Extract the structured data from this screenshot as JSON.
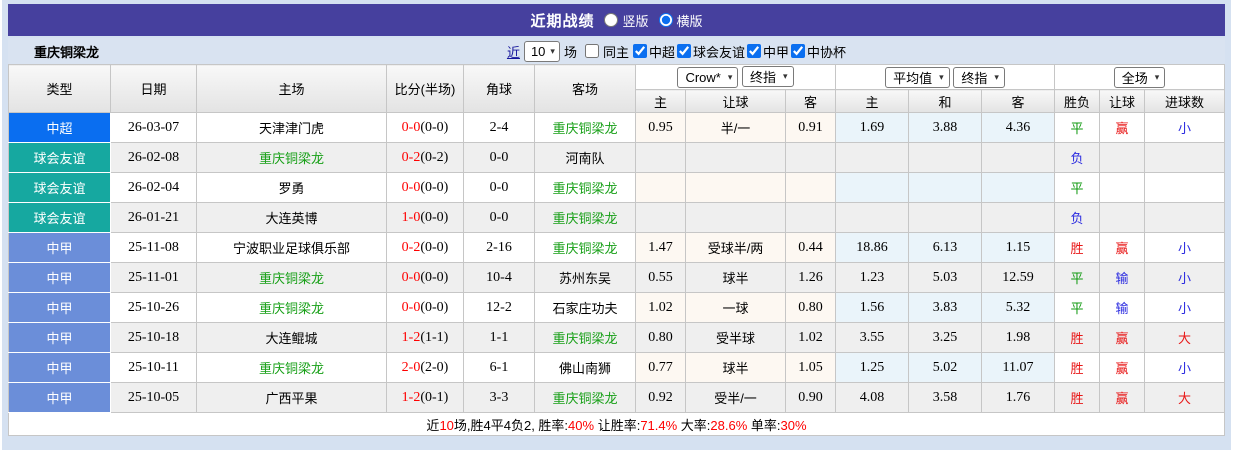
{
  "title_bar": {
    "title": "近期战绩",
    "radio_vertical": "竖版",
    "radio_horizontal": "横版",
    "selected": "横版"
  },
  "filter_bar": {
    "team": "重庆铜梁龙",
    "near_label": "近",
    "count_value": "10",
    "games_label": "场",
    "checkboxes": [
      {
        "label": "同主",
        "checked": false
      },
      {
        "label": "中超",
        "checked": true
      },
      {
        "label": "球会友谊",
        "checked": true
      },
      {
        "label": "中甲",
        "checked": true
      },
      {
        "label": "中协杯",
        "checked": true
      }
    ]
  },
  "selectors": {
    "bookmaker": "Crow*",
    "bookmaker_stage": "终指",
    "average": "平均值",
    "average_stage": "终指",
    "scope": "全场"
  },
  "columns": {
    "type": "类型",
    "date": "日期",
    "home": "主场",
    "score": "比分(半场)",
    "corner": "角球",
    "away": "客场",
    "odds_home": "主",
    "handicap": "让球",
    "odds_away": "客",
    "avg_home": "主",
    "avg_draw": "和",
    "avg_away": "客",
    "result": "胜负",
    "handicap_result": "让球",
    "goals": "进球数"
  },
  "league_colors": {
    "中超": "#0a6ef0",
    "球会友谊": "#16a8a0",
    "中甲": "#6b8ed9"
  },
  "rows": [
    {
      "league": "中超",
      "date": "26-03-07",
      "home": "天津津门虎",
      "home_green": false,
      "score": "0-0",
      "half": "(0-0)",
      "corner": "2-4",
      "away": "重庆铜梁龙",
      "away_green": true,
      "odds_home": "0.95",
      "handicap": "半/一",
      "odds_away": "0.91",
      "avg_home": "1.69",
      "avg_draw": "3.88",
      "avg_away": "4.36",
      "result": "平",
      "result_color": "green",
      "hresult": "赢",
      "hresult_color": "red",
      "goals": "小",
      "goals_color": "blue"
    },
    {
      "league": "球会友谊",
      "date": "26-02-08",
      "home": "重庆铜梁龙",
      "home_green": true,
      "score": "0-2",
      "half": "(0-2)",
      "corner": "0-0",
      "away": "河南队",
      "away_green": false,
      "odds_home": "",
      "handicap": "",
      "odds_away": "",
      "avg_home": "",
      "avg_draw": "",
      "avg_away": "",
      "result": "负",
      "result_color": "blue",
      "hresult": "",
      "hresult_color": "",
      "goals": "",
      "goals_color": ""
    },
    {
      "league": "球会友谊",
      "date": "26-02-04",
      "home": "罗勇",
      "home_green": false,
      "score": "0-0",
      "half": "(0-0)",
      "corner": "0-0",
      "away": "重庆铜梁龙",
      "away_green": true,
      "odds_home": "",
      "handicap": "",
      "odds_away": "",
      "avg_home": "",
      "avg_draw": "",
      "avg_away": "",
      "result": "平",
      "result_color": "green",
      "hresult": "",
      "hresult_color": "",
      "goals": "",
      "goals_color": ""
    },
    {
      "league": "球会友谊",
      "date": "26-01-21",
      "home": "大连英博",
      "home_green": false,
      "score": "1-0",
      "half": "(0-0)",
      "corner": "0-0",
      "away": "重庆铜梁龙",
      "away_green": true,
      "odds_home": "",
      "handicap": "",
      "odds_away": "",
      "avg_home": "",
      "avg_draw": "",
      "avg_away": "",
      "result": "负",
      "result_color": "blue",
      "hresult": "",
      "hresult_color": "",
      "goals": "",
      "goals_color": ""
    },
    {
      "league": "中甲",
      "date": "25-11-08",
      "home": "宁波职业足球俱乐部",
      "home_green": false,
      "score": "0-2",
      "half": "(0-0)",
      "corner": "2-16",
      "away": "重庆铜梁龙",
      "away_green": true,
      "odds_home": "1.47",
      "handicap": "受球半/两",
      "odds_away": "0.44",
      "avg_home": "18.86",
      "avg_draw": "6.13",
      "avg_away": "1.15",
      "result": "胜",
      "result_color": "red",
      "hresult": "赢",
      "hresult_color": "red",
      "goals": "小",
      "goals_color": "blue"
    },
    {
      "league": "中甲",
      "date": "25-11-01",
      "home": "重庆铜梁龙",
      "home_green": true,
      "score": "0-0",
      "half": "(0-0)",
      "corner": "10-4",
      "away": "苏州东吴",
      "away_green": false,
      "odds_home": "0.55",
      "handicap": "球半",
      "odds_away": "1.26",
      "avg_home": "1.23",
      "avg_draw": "5.03",
      "avg_away": "12.59",
      "result": "平",
      "result_color": "green",
      "hresult": "输",
      "hresult_color": "blue",
      "goals": "小",
      "goals_color": "blue"
    },
    {
      "league": "中甲",
      "date": "25-10-26",
      "home": "重庆铜梁龙",
      "home_green": true,
      "score": "0-0",
      "half": "(0-0)",
      "corner": "12-2",
      "away": "石家庄功夫",
      "away_green": false,
      "odds_home": "1.02",
      "handicap": "一球",
      "odds_away": "0.80",
      "avg_home": "1.56",
      "avg_draw": "3.83",
      "avg_away": "5.32",
      "result": "平",
      "result_color": "green",
      "hresult": "输",
      "hresult_color": "blue",
      "goals": "小",
      "goals_color": "blue"
    },
    {
      "league": "中甲",
      "date": "25-10-18",
      "home": "大连鲲城",
      "home_green": false,
      "score": "1-2",
      "half": "(1-1)",
      "corner": "1-1",
      "away": "重庆铜梁龙",
      "away_green": true,
      "odds_home": "0.80",
      "handicap": "受半球",
      "odds_away": "1.02",
      "avg_home": "3.55",
      "avg_draw": "3.25",
      "avg_away": "1.98",
      "result": "胜",
      "result_color": "red",
      "hresult": "赢",
      "hresult_color": "red",
      "goals": "大",
      "goals_color": "red"
    },
    {
      "league": "中甲",
      "date": "25-10-11",
      "home": "重庆铜梁龙",
      "home_green": true,
      "score": "2-0",
      "half": "(2-0)",
      "corner": "6-1",
      "away": "佛山南狮",
      "away_green": false,
      "odds_home": "0.77",
      "handicap": "球半",
      "odds_away": "1.05",
      "avg_home": "1.25",
      "avg_draw": "5.02",
      "avg_away": "11.07",
      "result": "胜",
      "result_color": "red",
      "hresult": "赢",
      "hresult_color": "red",
      "goals": "小",
      "goals_color": "blue"
    },
    {
      "league": "中甲",
      "date": "25-10-05",
      "home": "广西平果",
      "home_green": false,
      "score": "1-2",
      "half": "(0-1)",
      "corner": "3-3",
      "away": "重庆铜梁龙",
      "away_green": true,
      "odds_home": "0.92",
      "handicap": "受半/一",
      "odds_away": "0.90",
      "avg_home": "4.08",
      "avg_draw": "3.58",
      "avg_away": "1.76",
      "result": "胜",
      "result_color": "red",
      "hresult": "赢",
      "hresult_color": "red",
      "goals": "大",
      "goals_color": "red"
    }
  ],
  "footer": {
    "segments": [
      {
        "text": "近",
        "red": false
      },
      {
        "text": "10",
        "red": true
      },
      {
        "text": "场,胜4平4负2, 胜率:",
        "red": false
      },
      {
        "text": "40%",
        "red": true
      },
      {
        "text": " 让胜率:",
        "red": false
      },
      {
        "text": "71.4%",
        "red": true
      },
      {
        "text": " 大率:",
        "red": false
      },
      {
        "text": "28.6%",
        "red": true
      },
      {
        "text": " 单率:",
        "red": false
      },
      {
        "text": "30%",
        "red": true
      }
    ]
  },
  "arrow_glyph": "▾"
}
